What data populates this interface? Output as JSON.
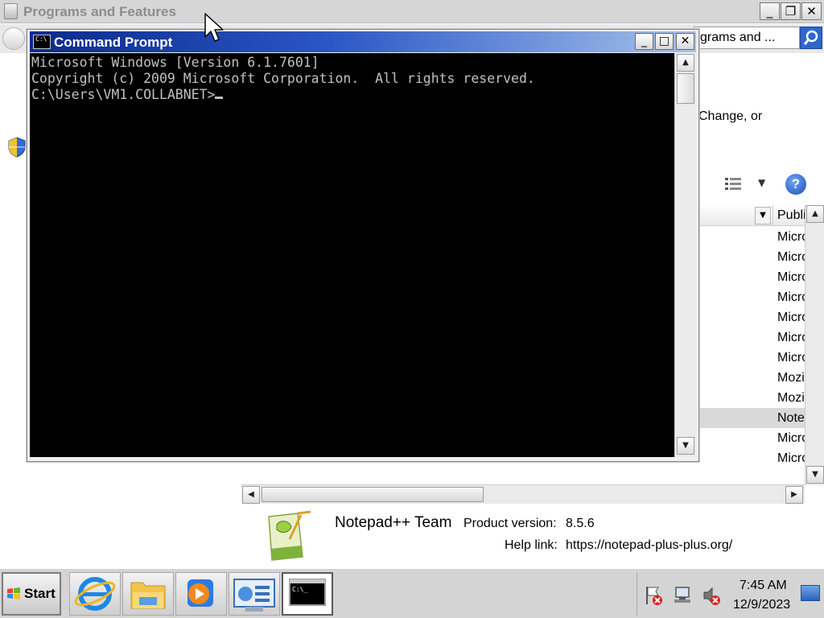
{
  "programs_window": {
    "title": "Programs and Features",
    "search_text": "grams and ...",
    "description_fragment": "Change, or",
    "column_header": "Publi",
    "publisher_rows": [
      "Micro",
      "Micro",
      "Micro",
      "Micro",
      "Micro",
      "Micro",
      "Micro",
      "Mozi",
      "Mozi",
      "Note",
      "Micro",
      "Micro"
    ],
    "selected_row_index": 9,
    "details": {
      "publisher": "Notepad++ Team",
      "product_version_label": "Product version:",
      "product_version": "8.5.6",
      "help_link_label": "Help link:",
      "help_link": "https://notepad-plus-plus.org/"
    },
    "icons": [
      "app-icon",
      "back-icon",
      "search-icon",
      "uac-shield-icon",
      "views-icon",
      "help-icon",
      "notepadpp-icon"
    ]
  },
  "cmd_window": {
    "title": "Command Prompt",
    "lines": [
      "Microsoft Windows [Version 6.1.7601]",
      "Copyright (c) 2009 Microsoft Corporation.  All rights reserved.",
      "",
      "C:\\Users\\VM1.COLLABNET>"
    ],
    "title_gradient": [
      "#0b2a8c",
      "#a6c3ea"
    ],
    "text_color": "#c0c0c0",
    "background": "#000000"
  },
  "taskbar": {
    "start_label": "Start",
    "apps": [
      "internet-explorer-icon",
      "windows-explorer-icon",
      "media-player-icon",
      "server-manager-icon",
      "command-prompt-icon"
    ],
    "active_app_index": 4,
    "time": "7:45 AM",
    "date": "12/9/2023",
    "tray_icons": [
      "action-center-flag-icon",
      "network-icon",
      "volume-icon"
    ]
  }
}
